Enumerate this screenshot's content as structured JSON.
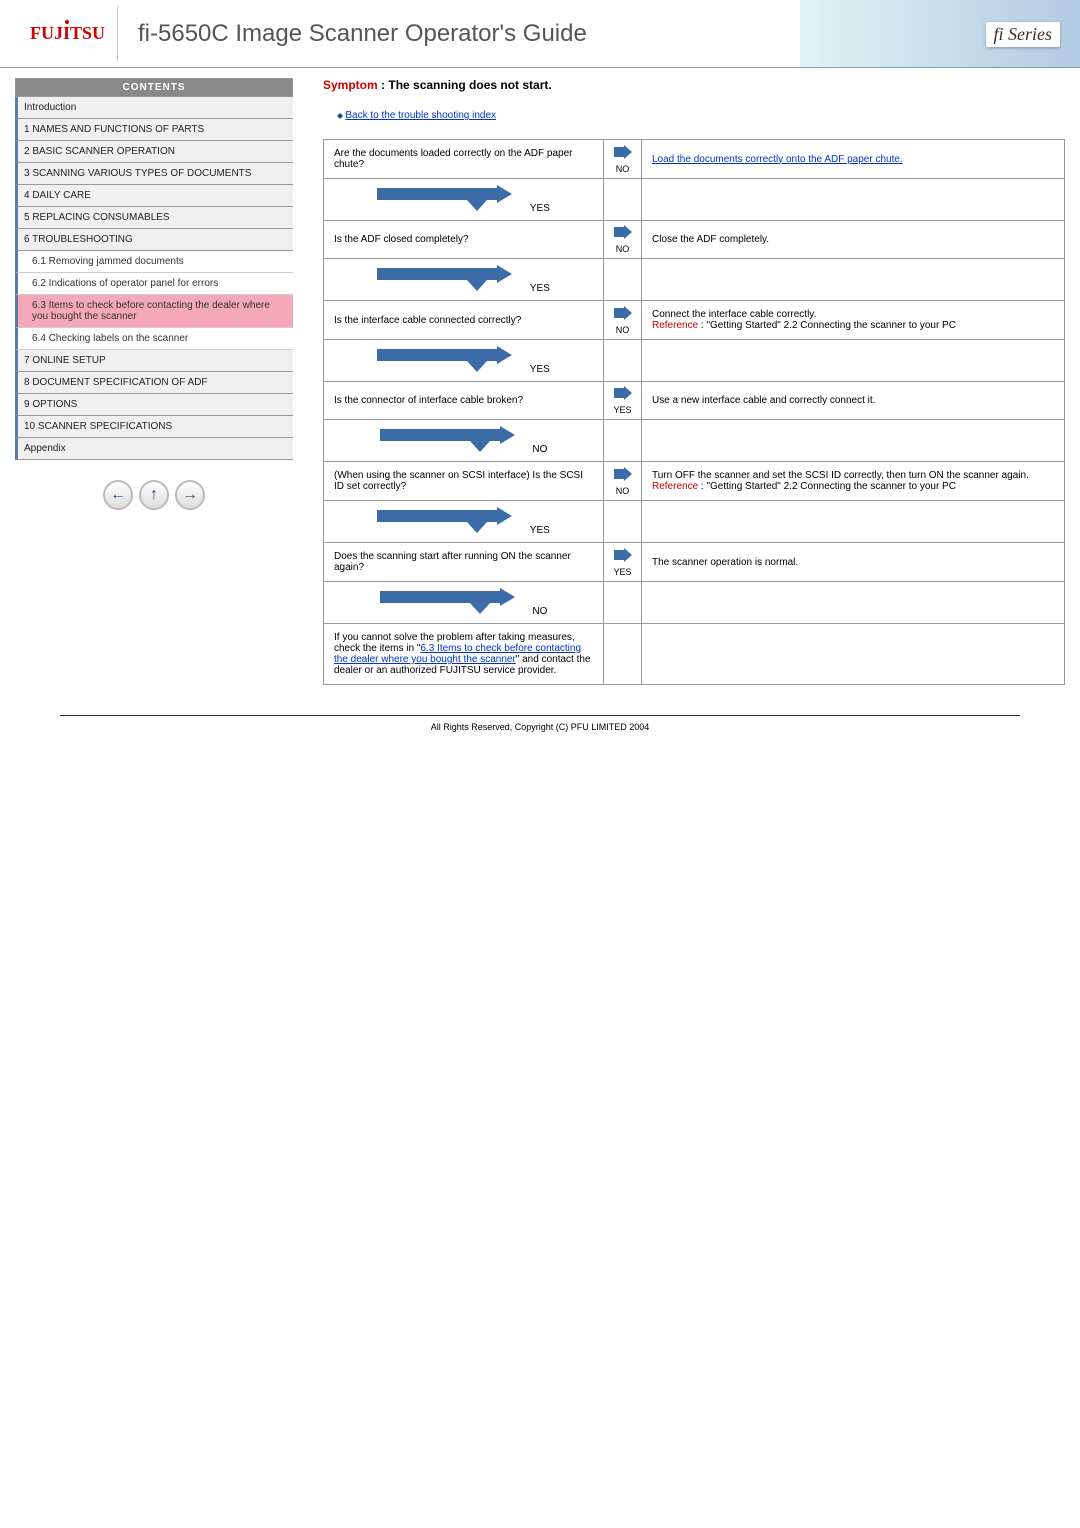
{
  "header": {
    "logo": "FUJITSU",
    "title": "fi-5650C Image Scanner Operator's Guide",
    "series": "fi Series"
  },
  "sidebar": {
    "contents_label": "CONTENTS",
    "items": [
      {
        "label": "Introduction",
        "type": "top"
      },
      {
        "label": "1 NAMES AND FUNCTIONS OF PARTS",
        "type": "top"
      },
      {
        "label": "2 BASIC SCANNER OPERATION",
        "type": "top"
      },
      {
        "label": "3 SCANNING VARIOUS TYPES OF DOCUMENTS",
        "type": "top"
      },
      {
        "label": "4 DAILY CARE",
        "type": "top"
      },
      {
        "label": "5 REPLACING CONSUMABLES",
        "type": "top"
      },
      {
        "label": "6 TROUBLESHOOTING",
        "type": "top"
      },
      {
        "label": "6.1 Removing jammed documents",
        "type": "sub"
      },
      {
        "label": "6.2 Indications of operator panel for errors",
        "type": "sub"
      },
      {
        "label": "6.3 Items to check before contacting the dealer where you bought the scanner",
        "type": "sub",
        "active": true
      },
      {
        "label": "6.4 Checking labels on the scanner",
        "type": "sub"
      },
      {
        "label": "7 ONLINE SETUP",
        "type": "top"
      },
      {
        "label": "8 DOCUMENT SPECIFICATION OF ADF",
        "type": "top"
      },
      {
        "label": "9 OPTIONS",
        "type": "top"
      },
      {
        "label": "10 SCANNER SPECIFICATIONS",
        "type": "top"
      },
      {
        "label": "Appendix",
        "type": "top"
      }
    ],
    "nav": {
      "prev": "←",
      "up": "↑",
      "next": "→"
    }
  },
  "content": {
    "symptom_label": "Symptom",
    "symptom_text": ": The scanning does not start.",
    "back_link": "Back to the trouble shooting index",
    "flow": [
      {
        "question": "Are the documents loaded correctly on the ADF paper chute?",
        "answer_no": "NO",
        "action_link": "Load the documents correctly onto the ADF paper chute.",
        "down": "YES"
      },
      {
        "question": "Is the ADF closed completely?",
        "answer_no": "NO",
        "action_text": "Close the ADF completely.",
        "down": "YES"
      },
      {
        "question": "Is the interface cable connected correctly?",
        "answer_no": "NO",
        "action_text": "Connect the interface cable correctly.",
        "ref_label": "Reference",
        "ref_text": " : \"Getting Started\" 2.2 Connecting the scanner to your PC",
        "down": "YES"
      },
      {
        "question": "Is the connector of interface cable broken?",
        "answer_no": "YES",
        "action_text": "Use a new interface cable and correctly connect it.",
        "down": "NO"
      },
      {
        "question": "(When using the scanner on SCSI interface) Is the SCSI ID set correctly?",
        "answer_no": "NO",
        "action_text": "Turn OFF the scanner and set the SCSI ID correctly, then turn ON the scanner again.",
        "ref_label": "Reference",
        "ref_text": " : \"Getting Started\" 2.2 Connecting the scanner to your PC",
        "down": "YES"
      },
      {
        "question": "Does the scanning start after running ON the scanner again?",
        "answer_no": "YES",
        "action_text": "The scanner operation is normal.",
        "down": "NO"
      }
    ],
    "final_pre": "If you cannot solve the problem after taking measures, check the items in \"",
    "final_link": "6.3 Items to check before contacting the dealer where you bought the scanner",
    "final_post": "\" and contact the dealer or an authorized FUJITSU service provider."
  },
  "footer": {
    "copyright": "All Rights Reserved, Copyright (C) PFU LIMITED 2004"
  }
}
